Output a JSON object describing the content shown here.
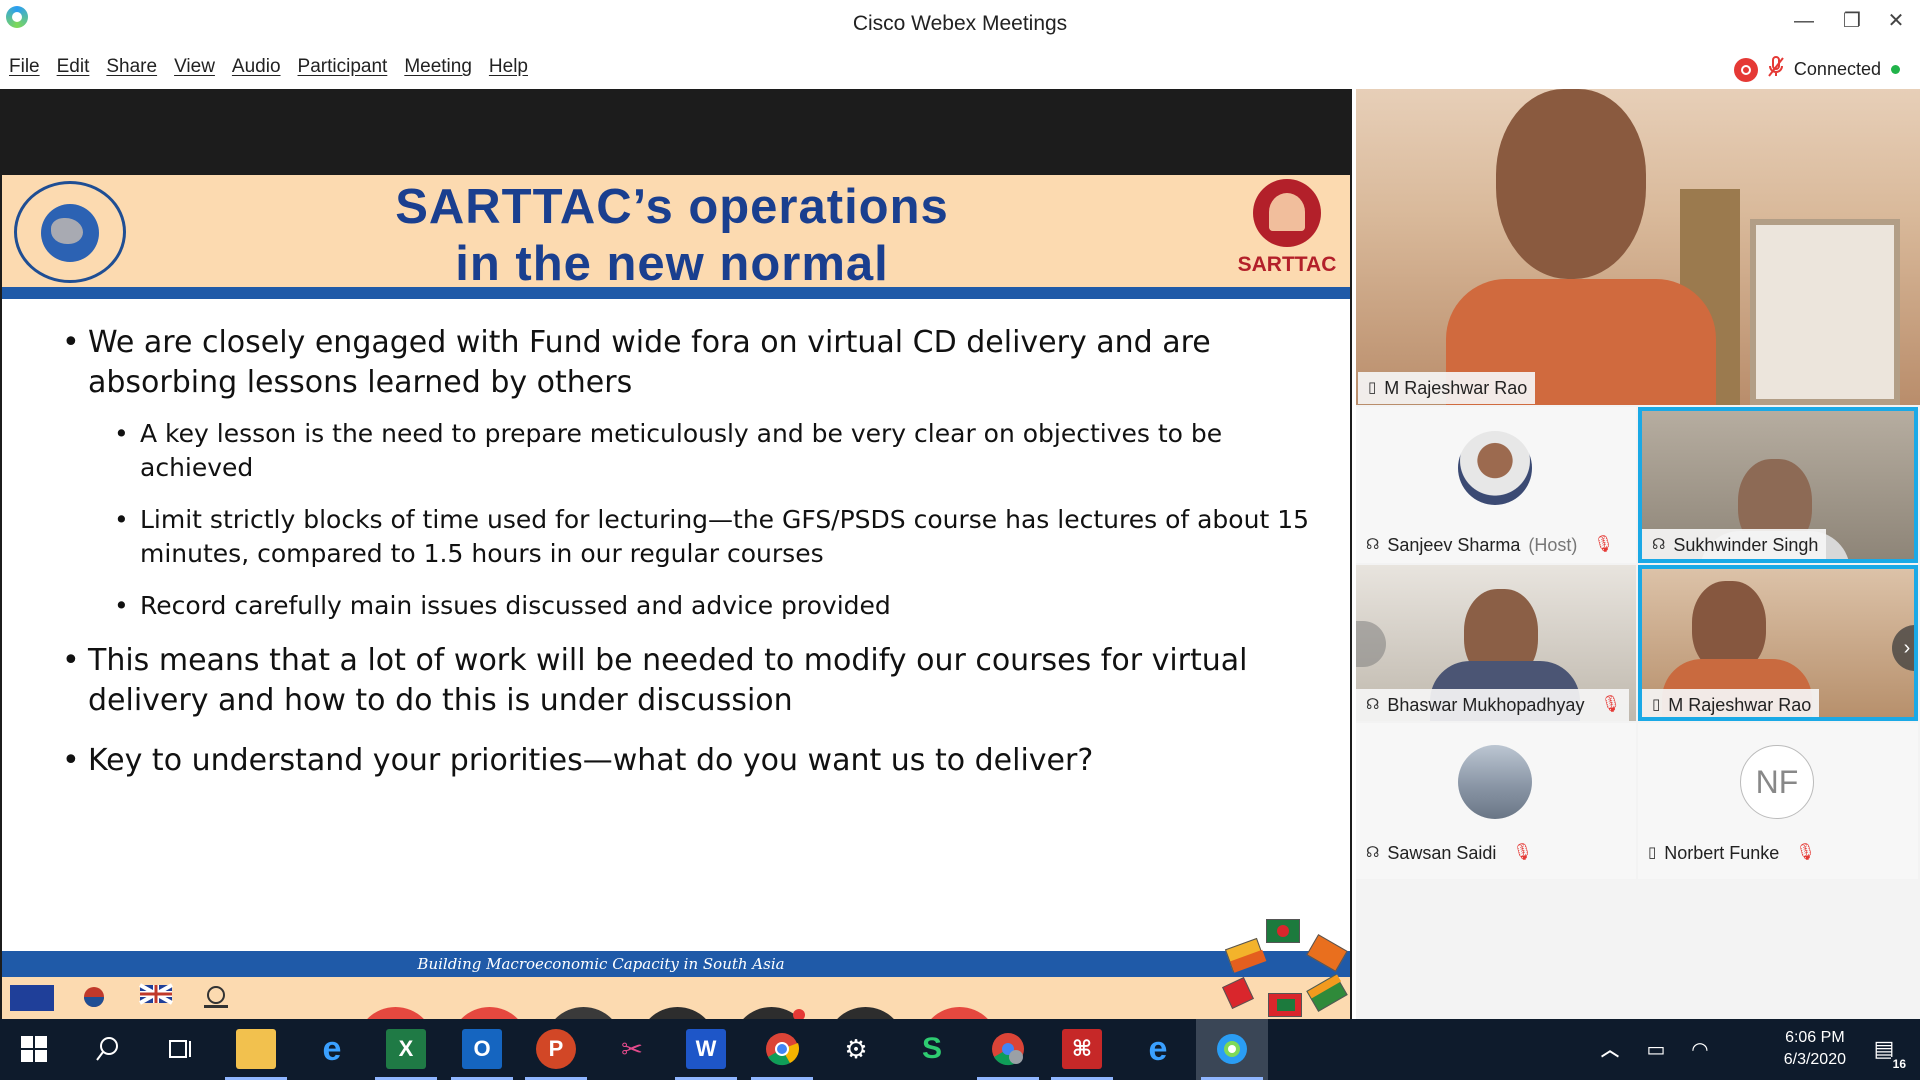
{
  "window": {
    "title": "Cisco Webex Meetings",
    "minimize": "—",
    "restore": "❐",
    "close": "✕"
  },
  "menu": [
    "File",
    "Edit",
    "Share",
    "View",
    "Audio",
    "Participant",
    "Meeting",
    "Help"
  ],
  "status": {
    "connection": "Connected"
  },
  "slide": {
    "title_line1": "SARTTAC’s operations",
    "title_line2": "in the new normal",
    "logo_text": "SARTTAC",
    "bullet1": "We are closely engaged with Fund wide fora on virtual CD delivery and are absorbing lessons learned by others",
    "sub1": "A key lesson is the need to prepare meticulously and be very clear on objectives to be achieved",
    "sub2": "Limit strictly blocks of time used for lecturing—the GFS/PSDS course has lectures of about 15 minutes, compared to 1.5 hours in our regular courses",
    "sub3": "Record carefully main issues discussed and advice provided",
    "bullet2": "This means that a lot of work will be needed to modify our courses for virtual delivery and how to do this is under discussion",
    "bullet3": "Key to understand your priorities—what do you want us to deliver?",
    "footer": "Building Macroeconomic Capacity in South Asia"
  },
  "controls": [
    {
      "name": "mute-button",
      "icon": "mic-off-icon"
    },
    {
      "name": "stop-video-button",
      "icon": "camera-off-icon"
    },
    {
      "name": "share-button",
      "icon": "share-icon"
    },
    {
      "name": "participants-button",
      "icon": "participants-icon"
    },
    {
      "name": "chat-button",
      "icon": "chat-icon"
    },
    {
      "name": "more-button",
      "icon": "more-icon",
      "label": "···"
    },
    {
      "name": "leave-button",
      "icon": "close-icon",
      "label": "✕"
    }
  ],
  "participants": {
    "main": {
      "name": "M Rajeshwar Rao"
    },
    "tiles": [
      {
        "name": "Sanjeev Sharma",
        "suffix": "(Host)",
        "muted": true
      },
      {
        "name": "Sukhwinder Singh",
        "muted": false,
        "active": true
      },
      {
        "name": "Bhaswar Mukhopadhyay",
        "muted": true
      },
      {
        "name": "M Rajeshwar Rao",
        "muted": false,
        "active": true
      },
      {
        "name": "Sawsan Saidi",
        "muted": true
      },
      {
        "name": "Norbert Funke",
        "initials": "NF",
        "muted": true
      }
    ]
  },
  "taskbar": {
    "time": "6:06 PM",
    "date": "6/3/2020",
    "notification_count": "16"
  },
  "colors": {
    "accent": "#1aa9e6",
    "end_red": "#e5483f",
    "slide_blue": "#1f5aa8",
    "slide_header": "#fcdab0"
  }
}
